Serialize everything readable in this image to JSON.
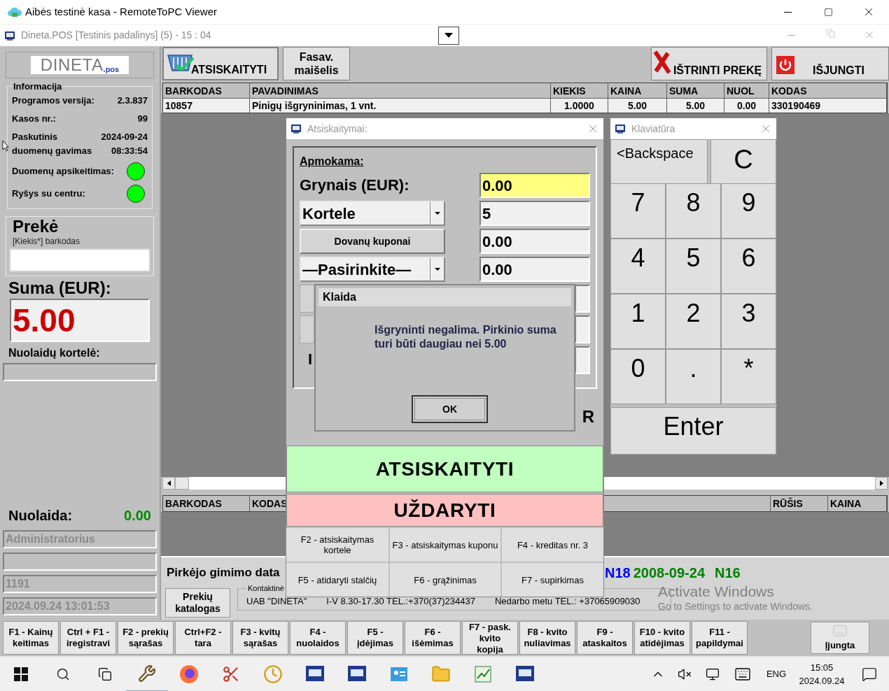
{
  "os_window": {
    "title": "Aibės testinė kasa - RemoteToPC Viewer"
  },
  "app_window": {
    "title": "Dineta.POS [Testinis padalinys] (5) - 15 : 04"
  },
  "sidebar": {
    "logo": {
      "word": "DINETA",
      "suffix": ".pos"
    },
    "info": {
      "title": "Informacija",
      "rows": [
        {
          "kind": "text",
          "label": "Programos versija:",
          "value": "2.3.837"
        },
        {
          "kind": "text",
          "label": "Kasos nr.:",
          "value": "99"
        },
        {
          "kind": "text",
          "label": "Paskutinis\nduomenų gavimas",
          "value": "2024-09-24\n08:33:54"
        },
        {
          "kind": "status",
          "label": "Duomenų apsikeitimas:",
          "color": "#00ff00"
        },
        {
          "kind": "status",
          "label": "Ryšys su centru:",
          "color": "#00ff00"
        }
      ]
    },
    "item": {
      "title": "Prekė",
      "hint": "[Kiekis*] barkodas"
    },
    "total": {
      "label": "Suma (EUR):",
      "value": "5.00"
    },
    "discount_card": {
      "label": "Nuolaidų kortelė:"
    },
    "discount": {
      "label": "Nuolaida:",
      "value": "0.00"
    },
    "status_fields": [
      "Administratorius",
      "1191",
      "2024.09.24 13:01:53"
    ]
  },
  "toolbar": {
    "left": [
      {
        "kind": "checkout",
        "label": "ATSISKAITYTI"
      },
      {
        "kind": "plain",
        "label": "Fasav.\nmaišelis"
      }
    ],
    "right": [
      {
        "kind": "delete",
        "label": "IŠTRINTI PREKĘ"
      },
      {
        "kind": "power",
        "label": "IŠJUNGTI"
      }
    ]
  },
  "items_table": {
    "columns": [
      {
        "label": "BARKODAS",
        "kind": "text"
      },
      {
        "label": "PAVADINIMAS",
        "kind": "text"
      },
      {
        "label": "KIEKIS",
        "kind": "number"
      },
      {
        "label": "KAINA",
        "kind": "number"
      },
      {
        "label": "SUMA",
        "kind": "number"
      },
      {
        "label": "NUOL",
        "kind": "number"
      },
      {
        "label": "KODAS",
        "kind": "text"
      }
    ],
    "rows": [
      [
        "10857",
        "Pinigų išgryninimas, 1 vnt.",
        "1.0000",
        "5.00",
        "5.00",
        "0.00",
        "330190469"
      ]
    ]
  },
  "lower_table": {
    "columns": [
      "BARKODAS",
      "KODAS",
      "RŪŠIS",
      "KAINA"
    ]
  },
  "customer_panel": {
    "birth_label": "Pirkėjo gimimo data",
    "tags": [
      {
        "text": "N18",
        "color": "#0000ff"
      },
      {
        "text": "2008-09-24",
        "color": "#008000"
      },
      {
        "text": "N16",
        "color": "#008000"
      }
    ],
    "catalog_button": "Prekių\nkatalogas",
    "contact": {
      "legend": "Kontaktinė",
      "parts": [
        "UAB \"DINETA\"",
        "I-V 8.30-17.30 TEL.:+370(37)234437",
        "Nedarbo metu TEL.: +37065909030"
      ]
    }
  },
  "payment_dialog": {
    "title": "Atsiskaitymai:",
    "heading": "Apmokama:",
    "rows": [
      {
        "kind": "label",
        "label": "Grynais (EUR):",
        "value": "0.00",
        "highlighted": true
      },
      {
        "kind": "select",
        "label": "Kortele",
        "value": "5",
        "highlighted": false
      },
      {
        "kind": "button",
        "label": "Dovanų kuponai",
        "value": "0.00",
        "highlighted": false
      },
      {
        "kind": "select",
        "label": "—Pasirinkite—",
        "value": "0.00",
        "highlighted": false
      }
    ],
    "partial_label": "I",
    "partial_right": "R",
    "pay_button": "ATSISKAITYTI",
    "close_button": "UŽDARYTI",
    "shortcuts": [
      "F2 - atsiskaitymas\nkortele",
      "F3 - atsiskaitymas kuponu",
      "F4 - kreditas nr. 3",
      "F5 - atidaryti stalčių",
      "F6 - grąžinimas",
      "F7 - supirkimas"
    ]
  },
  "keypad": {
    "title": "Klaviatūra",
    "keys": [
      {
        "kind": "backspace",
        "label": "<Backspace"
      },
      {
        "kind": "clear",
        "label": "C"
      },
      {
        "kind": "digit",
        "label": "7"
      },
      {
        "kind": "digit",
        "label": "8"
      },
      {
        "kind": "digit",
        "label": "9"
      },
      {
        "kind": "digit",
        "label": "4"
      },
      {
        "kind": "digit",
        "label": "5"
      },
      {
        "kind": "digit",
        "label": "6"
      },
      {
        "kind": "digit",
        "label": "1"
      },
      {
        "kind": "digit",
        "label": "2"
      },
      {
        "kind": "digit",
        "label": "3"
      },
      {
        "kind": "digit",
        "label": "0"
      },
      {
        "kind": "digit",
        "label": "."
      },
      {
        "kind": "digit",
        "label": "*"
      },
      {
        "kind": "enter",
        "label": "Enter"
      }
    ]
  },
  "error_dialog": {
    "title": "Klaida",
    "message": "Išgryninti negalima. Pirkinio suma\nturi būti daugiau nei 5.00",
    "ok": "OK"
  },
  "function_keys": [
    "F1 - Kainų\nkeitimas",
    "Ctrl + F1 -\niregistravi",
    "F2 - prekių\nsąrašas",
    "Ctrl+F2 -\ntara",
    "F3 - kvitų\nsąrašas",
    "F4 -\nnuolaidos",
    "F5 -\nįdėjimas",
    "F6 -\nišėmimas",
    "F7 - pask.\nkvito\nkopija",
    "F8 - kvito\nnuliavimas",
    "F9 -\nataskaitos",
    "F10 - kvito\natidėjimas",
    "F11 -\npapildymai"
  ],
  "keyboard_toggle": "Įjungta",
  "activation": {
    "title": "Activate Windows",
    "text": "Go to Settings to activate Windows."
  },
  "taskbar": {
    "language": "ENG",
    "time": "15:05",
    "date": "2024.09.24"
  }
}
